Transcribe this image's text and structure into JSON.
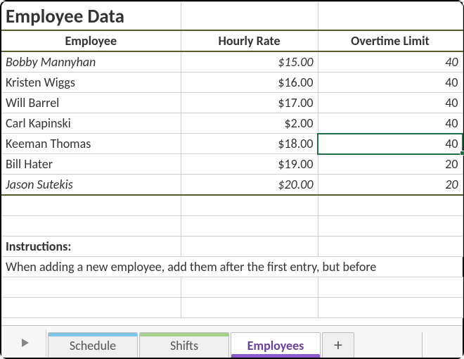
{
  "title": "Employee Data",
  "columns": [
    "Employee",
    "Hourly Rate",
    "Overtime Limit"
  ],
  "rows": [
    {
      "name": "Bobby Mannyhan",
      "rate": "$15.00",
      "limit": "40",
      "italic": true
    },
    {
      "name": "Kristen Wiggs",
      "rate": "$16.00",
      "limit": "40"
    },
    {
      "name": "Will Barrel",
      "rate": "$17.00",
      "limit": "40"
    },
    {
      "name": "Carl Kapinski",
      "rate": "$2.00",
      "limit": "40"
    },
    {
      "name": "Keeman Thomas",
      "rate": "$18.00",
      "limit": "40",
      "selected": true
    },
    {
      "name": "Bill Hater",
      "rate": "$19.00",
      "limit": "20"
    },
    {
      "name": "Jason Sutekis",
      "rate": "$20.00",
      "limit": "20",
      "italic": true,
      "last": true
    }
  ],
  "instructions_label": "Instructions:",
  "instructions_text": "When adding a new employee, add them after the first entry, but before",
  "tabs": {
    "schedule": {
      "label": "Schedule",
      "color": "#7cc7e8"
    },
    "shifts": {
      "label": "Shifts",
      "color": "#a8d08d"
    },
    "employees": {
      "label": "Employees",
      "color": "#8e5bcf"
    }
  },
  "add_tab_label": "+"
}
